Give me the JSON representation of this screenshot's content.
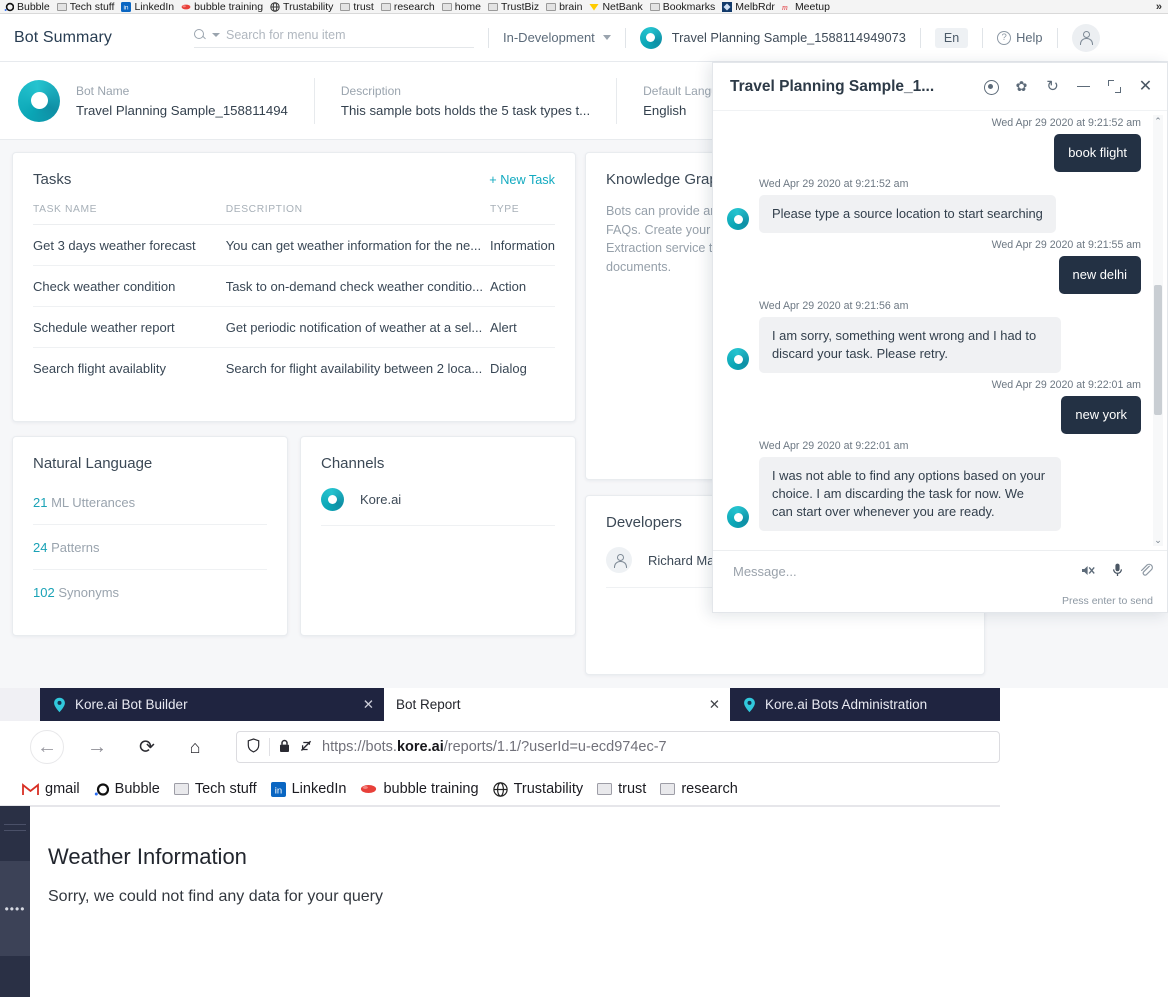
{
  "top_browser_bookmarks": [
    {
      "label": "Bubble",
      "icon": "bubble-icon"
    },
    {
      "label": "Tech stuff",
      "icon": "folder-icon"
    },
    {
      "label": "LinkedIn",
      "icon": "linkedin-icon"
    },
    {
      "label": "bubble training",
      "icon": "bubble-training-icon"
    },
    {
      "label": "Trustability",
      "icon": "globe-icon"
    },
    {
      "label": "trust",
      "icon": "folder-icon"
    },
    {
      "label": "research",
      "icon": "folder-icon"
    },
    {
      "label": "home",
      "icon": "folder-icon"
    },
    {
      "label": "TrustBiz",
      "icon": "folder-icon"
    },
    {
      "label": "brain",
      "icon": "folder-icon"
    },
    {
      "label": "NetBank",
      "icon": "netbank-icon"
    },
    {
      "label": "Bookmarks",
      "icon": "folder-icon"
    },
    {
      "label": "MelbRdr",
      "icon": "melbrdr-icon"
    },
    {
      "label": "Meetup",
      "icon": "meetup-icon"
    }
  ],
  "top_browser_overflow": "»",
  "app": {
    "title": "Bot Summary",
    "search": {
      "placeholder": "Search for menu item",
      "icon": "search-icon"
    },
    "environment": "In-Development",
    "bot_chip_name": "Travel Planning Sample_1588114949073",
    "language_pill": "En",
    "help_label": "Help",
    "avatar_icon": "user-avatar-icon"
  },
  "bot_band": [
    {
      "label": "Bot Name",
      "value": "Travel Planning Sample_158811494"
    },
    {
      "label": "Description",
      "value": "This sample bots holds the 5 task types t..."
    },
    {
      "label": "Default Language",
      "value": "English"
    }
  ],
  "tasks_card": {
    "title": "Tasks",
    "new_task": "+ New Task",
    "columns": [
      "TASK NAME",
      "DESCRIPTION",
      "TYPE"
    ],
    "rows": [
      [
        "Get 3 days weather forecast",
        "You can get weather information for the ne...",
        "Information"
      ],
      [
        "Check weather condition",
        "Task to on-demand check weather conditio...",
        "Action"
      ],
      [
        "Schedule weather report",
        "Get periodic notification of weather at a sel...",
        "Alert"
      ],
      [
        "Search flight availablity",
        "Search for flight availability between 2 loca...",
        "Dialog"
      ]
    ]
  },
  "knowledge_graph_card": {
    "title": "Knowledge Graph",
    "text": "Bots can provide answers to user questions by querying a set of FAQs. Create your own graph and add relevant FAQs. Use the Extraction service to extract FAQs from web pages and documents."
  },
  "natural_language_card": {
    "title": "Natural Language",
    "rows": [
      {
        "count": "21",
        "label": "ML Utterances"
      },
      {
        "count": "24",
        "label": "Patterns"
      },
      {
        "count": "102",
        "label": "Synonyms"
      }
    ]
  },
  "channels_card": {
    "title": "Channels",
    "items": [
      {
        "name": "Kore.ai",
        "icon": "kore-logo-icon"
      }
    ]
  },
  "developers_card": {
    "title": "Developers",
    "items": [
      {
        "name": "Richard Mar",
        "icon": "person-avatar-icon"
      }
    ]
  },
  "chat": {
    "title": "Travel Planning Sample_1...",
    "actions": [
      {
        "name": "record-icon",
        "glyph": ""
      },
      {
        "name": "settings-icon",
        "glyph": "✿"
      },
      {
        "name": "refresh-icon",
        "glyph": "↻"
      },
      {
        "name": "minimize-icon",
        "glyph": ""
      },
      {
        "name": "maximize-icon",
        "glyph": ""
      },
      {
        "name": "close-icon",
        "glyph": "✕"
      }
    ],
    "messages": [
      {
        "side": "user",
        "time": "Wed Apr 29 2020 at 9:21:52 am",
        "text": "book flight"
      },
      {
        "side": "bot",
        "time": "Wed Apr 29 2020 at 9:21:52 am",
        "text": "Please type a source location to start searching"
      },
      {
        "side": "user",
        "time": "Wed Apr 29 2020 at 9:21:55 am",
        "text": "new delhi"
      },
      {
        "side": "bot",
        "time": "Wed Apr 29 2020 at 9:21:56 am",
        "text": "I am sorry, something went wrong and I had to discard your task. Please retry."
      },
      {
        "side": "user",
        "time": "Wed Apr 29 2020 at 9:22:01 am",
        "text": "new york"
      },
      {
        "side": "bot",
        "time": "Wed Apr 29 2020 at 9:22:01 am",
        "text": "I was not able to find any options based on your choice. I am discarding the task for now. We can start over whenever you are ready."
      }
    ],
    "input_placeholder": "Message...",
    "hint": "Press enter to send",
    "footer_icons": [
      {
        "name": "speaker-mute-icon",
        "glyph": "🕨"
      },
      {
        "name": "microphone-icon",
        "glyph": "🎤"
      },
      {
        "name": "attachment-icon",
        "glyph": "🖉"
      }
    ],
    "scroll_up_glyph": "⌃",
    "scroll_down_glyph": "⌄"
  },
  "browser": {
    "tabs": [
      {
        "label": "Kore.ai Bot Builder",
        "active": false,
        "favicon": "kore-pin-icon",
        "close": "✕"
      },
      {
        "label": "Bot Report",
        "active": true,
        "favicon": "none",
        "close": "✕"
      },
      {
        "label": "Kore.ai Bots Administration",
        "active": false,
        "favicon": "kore-pin-icon",
        "close": "✕"
      }
    ],
    "nav": [
      {
        "name": "back-button",
        "glyph": "←"
      },
      {
        "name": "forward-button",
        "glyph": "→"
      },
      {
        "name": "reload-button",
        "glyph": "⟳"
      },
      {
        "name": "home-button",
        "glyph": "⌂"
      }
    ],
    "url": {
      "shield_glyph": "⛉",
      "lock_glyph": "🔒",
      "noscript_glyph": "⊘",
      "prefix": "https://bots.",
      "domain": "kore.ai",
      "suffix": "/reports/1.1/?userId=u-ecd974ec-7"
    },
    "bookmarks": [
      {
        "label": "gmail",
        "icon": "gmail-icon"
      },
      {
        "label": "Bubble",
        "icon": "bubble-icon"
      },
      {
        "label": "Tech stuff",
        "icon": "folder-icon"
      },
      {
        "label": "LinkedIn",
        "icon": "linkedin-icon"
      },
      {
        "label": "bubble training",
        "icon": "bubble-training-icon"
      },
      {
        "label": "Trustability",
        "icon": "globe-icon"
      },
      {
        "label": "trust",
        "icon": "folder-icon"
      },
      {
        "label": "research",
        "icon": "folder-icon"
      }
    ],
    "report": {
      "title": "Weather Information",
      "message": "Sorry, we could not find any data for your query",
      "sidebar_dots": "••••"
    }
  }
}
